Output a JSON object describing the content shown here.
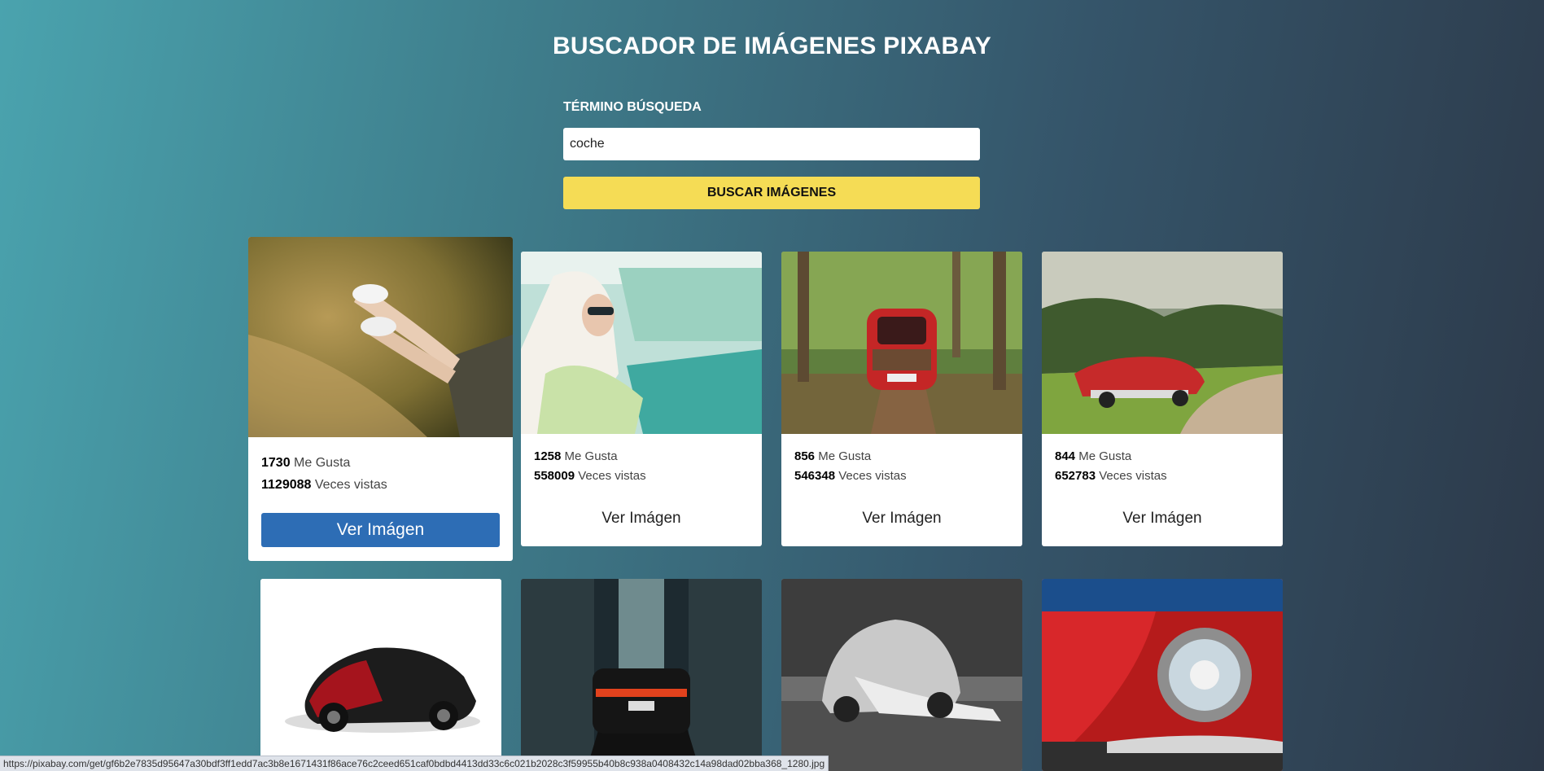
{
  "header": {
    "title": "BUSCADOR DE IMÁGENES PIXABAY"
  },
  "search": {
    "label": "TÉRMINO BÚSQUEDA",
    "value": "coche",
    "button_label": "BUSCAR IMÁGENES"
  },
  "cards": [
    {
      "likes": "1730",
      "likes_label": "Me Gusta",
      "views": "1129088",
      "views_label": "Veces vistas",
      "button_label": "Ver Imágen",
      "image": "legs-out-car-window"
    },
    {
      "likes": "1258",
      "likes_label": "Me Gusta",
      "views": "558009",
      "views_label": "Veces vistas",
      "button_label": "Ver Imágen",
      "image": "woman-driving-vintage-car"
    },
    {
      "likes": "856",
      "likes_label": "Me Gusta",
      "views": "546348",
      "views_label": "Veces vistas",
      "button_label": "Ver Imágen",
      "image": "red-fiat-in-forest"
    },
    {
      "likes": "844",
      "likes_label": "Me Gusta",
      "views": "652783",
      "views_label": "Veces vistas",
      "button_label": "Ver Imágen",
      "image": "red-classic-convertible"
    },
    {
      "image": "bugatti-sports-car"
    },
    {
      "image": "car-taillights-city-street"
    },
    {
      "image": "mechanic-under-beetle"
    },
    {
      "image": "red-car-headlight"
    }
  ],
  "status_bar": {
    "url": "https://pixabay.com/get/gf6b2e7835d95647a30bdf3ff1edd7ac3b8e1671431f86ace76c2ceed651caf0bdbd4413dd33c6c021b2028c3f59955b40b8c938a0408432c14a98dad02bba368_1280.jpg"
  },
  "colors": {
    "accent_button": "#f5dc55",
    "view_button_active": "#2d6db5"
  }
}
